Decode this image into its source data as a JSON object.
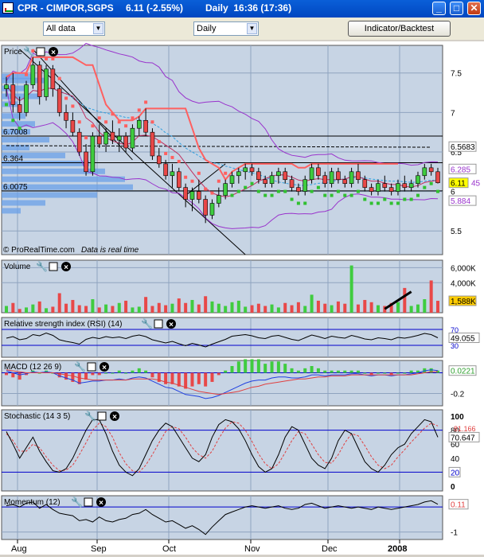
{
  "window": {
    "title_symbol": "CPR - CIMPOR,SGPS",
    "title_price": "6.11 (-2.55%)",
    "title_interval": "Daily  16:36 (17:36)",
    "minimize": "_",
    "maximize": "□",
    "close": "✕"
  },
  "toolbar": {
    "data_select": "All data",
    "period_select": "Daily",
    "indicator_button": "Indicator/Backtest"
  },
  "colors": {
    "panel_bg": "#c7d4e4",
    "up": "#3fcc3f",
    "down": "#e84848",
    "sar_red": "#ff6060",
    "sar_green": "#30c030",
    "band": "#9933cc"
  },
  "chart_data": [
    {
      "type": "candlestick",
      "panel": "Price",
      "x_ticks": [
        "Aug",
        "Sep",
        "Oct",
        "Nov",
        "Dec",
        "2008"
      ],
      "y_ticks": [
        7.5,
        7,
        6.5,
        6,
        5.5
      ],
      "ylim": [
        5.2,
        7.85
      ],
      "ohlc": [
        [
          7.3,
          7.45,
          7.2,
          7.35
        ],
        [
          7.35,
          7.5,
          7.0,
          7.1
        ],
        [
          7.1,
          7.2,
          6.9,
          7.0
        ],
        [
          7.0,
          7.4,
          6.95,
          7.35
        ],
        [
          7.35,
          7.7,
          7.3,
          7.6
        ],
        [
          7.6,
          7.65,
          7.1,
          7.2
        ],
        [
          7.2,
          7.6,
          7.15,
          7.55
        ],
        [
          7.55,
          7.6,
          7.2,
          7.3
        ],
        [
          7.3,
          7.35,
          6.95,
          7.0
        ],
        [
          7.0,
          7.1,
          6.8,
          6.9
        ],
        [
          6.9,
          7.0,
          6.7,
          6.75
        ],
        [
          6.75,
          6.8,
          6.45,
          6.5
        ],
        [
          6.5,
          6.6,
          6.2,
          6.25
        ],
        [
          6.25,
          6.75,
          6.2,
          6.7
        ],
        [
          6.7,
          6.85,
          6.55,
          6.6
        ],
        [
          6.6,
          6.8,
          6.5,
          6.75
        ],
        [
          6.75,
          6.9,
          6.6,
          6.65
        ],
        [
          6.65,
          6.8,
          6.5,
          6.7
        ],
        [
          6.7,
          6.75,
          6.5,
          6.55
        ],
        [
          6.55,
          6.85,
          6.5,
          6.8
        ],
        [
          6.8,
          6.95,
          6.7,
          6.9
        ],
        [
          6.9,
          7.05,
          6.7,
          6.75
        ],
        [
          6.75,
          6.8,
          6.4,
          6.45
        ],
        [
          6.45,
          6.55,
          6.3,
          6.35
        ],
        [
          6.35,
          6.4,
          6.15,
          6.2
        ],
        [
          6.2,
          6.35,
          6.05,
          6.25
        ],
        [
          6.25,
          6.3,
          6.0,
          6.05
        ],
        [
          6.05,
          6.1,
          5.8,
          5.9
        ],
        [
          5.9,
          6.05,
          5.75,
          6.0
        ],
        [
          6.0,
          6.15,
          5.85,
          5.9
        ],
        [
          5.9,
          5.95,
          5.6,
          5.7
        ],
        [
          5.7,
          5.9,
          5.65,
          5.85
        ],
        [
          5.85,
          6.05,
          5.8,
          5.95
        ],
        [
          5.95,
          6.15,
          5.9,
          6.1
        ],
        [
          6.1,
          6.25,
          6.05,
          6.2
        ],
        [
          6.2,
          6.3,
          6.1,
          6.25
        ],
        [
          6.25,
          6.35,
          6.15,
          6.3
        ],
        [
          6.3,
          6.35,
          6.2,
          6.25
        ],
        [
          6.25,
          6.3,
          6.1,
          6.15
        ],
        [
          6.15,
          6.2,
          6.05,
          6.1
        ],
        [
          6.1,
          6.25,
          6.05,
          6.2
        ],
        [
          6.2,
          6.3,
          6.1,
          6.25
        ],
        [
          6.25,
          6.3,
          6.1,
          6.15
        ],
        [
          6.15,
          6.2,
          6.0,
          6.05
        ],
        [
          6.05,
          6.1,
          5.95,
          6.0
        ],
        [
          6.0,
          6.2,
          5.95,
          6.15
        ],
        [
          6.15,
          6.35,
          6.1,
          6.3
        ],
        [
          6.3,
          6.35,
          6.15,
          6.2
        ],
        [
          6.2,
          6.25,
          6.05,
          6.1
        ],
        [
          6.1,
          6.3,
          6.05,
          6.25
        ],
        [
          6.25,
          6.3,
          6.1,
          6.15
        ],
        [
          6.15,
          6.2,
          6.05,
          6.1
        ],
        [
          6.1,
          6.3,
          6.05,
          6.25
        ],
        [
          6.25,
          6.35,
          6.1,
          6.15
        ],
        [
          6.15,
          6.2,
          6.0,
          6.05
        ],
        [
          6.05,
          6.1,
          5.95,
          6.0
        ],
        [
          6.0,
          6.15,
          5.95,
          6.1
        ],
        [
          6.1,
          6.2,
          6.0,
          6.05
        ],
        [
          6.05,
          6.1,
          5.95,
          6.0
        ],
        [
          6.0,
          6.15,
          5.95,
          6.1
        ],
        [
          6.1,
          6.2,
          6.0,
          6.05
        ],
        [
          6.05,
          6.15,
          6.0,
          6.1
        ],
        [
          6.1,
          6.25,
          6.05,
          6.2
        ],
        [
          6.2,
          6.35,
          6.15,
          6.3
        ],
        [
          6.3,
          6.35,
          6.2,
          6.25
        ],
        [
          6.25,
          6.3,
          6.1,
          6.11
        ]
      ],
      "horizontal_levels": [
        {
          "label": "6.7008",
          "value": 6.7008
        },
        {
          "label": "6.364",
          "value": 6.364
        },
        {
          "label": "6.0075",
          "value": 6.0075
        }
      ],
      "right_labels": [
        {
          "label": "6.5683",
          "value": 6.5683,
          "color": "#ffffff"
        },
        {
          "label": "6.285",
          "value": 6.285,
          "color": "#9933cc"
        },
        {
          "label": "6.11",
          "value": 6.11,
          "color": "#ffff00"
        },
        {
          "label": "45",
          "value": 6.11,
          "color": "#9933cc"
        },
        {
          "label": "5.884",
          "value": 5.884,
          "color": "#9933cc"
        }
      ],
      "footer_left": "© ProRealTime.com",
      "footer_right": "Data is real time"
    },
    {
      "type": "bar",
      "panel": "Volume",
      "y_ticks": [
        "6,000K",
        "4,000K"
      ],
      "ylim": [
        0,
        7000
      ],
      "last_label": "1,588K",
      "values": [
        900,
        1300,
        500,
        700,
        1100,
        1500,
        600,
        800,
        2600,
        1200,
        1700,
        1000,
        900,
        1800,
        700,
        1100,
        900,
        1300,
        1600,
        700,
        800,
        2100,
        900,
        1300,
        1000,
        1200,
        1900,
        1300,
        1700,
        1100,
        2200,
        1500,
        1200,
        900,
        1400,
        1600,
        800,
        1000,
        1200,
        900,
        1100,
        700,
        1300,
        1000,
        1400,
        900,
        2400,
        1600,
        1200,
        1000,
        1500,
        1200,
        6300,
        1100,
        1700,
        1400,
        1000,
        900,
        1300,
        1400,
        3300,
        900,
        1100,
        1800,
        4300,
        1588
      ]
    },
    {
      "type": "line",
      "panel": "Relative strength index (RSI) (14)",
      "y_ticks": [
        "70",
        "30"
      ],
      "ylim": [
        0,
        100
      ],
      "last_label": "49.055",
      "values": [
        48,
        52,
        44,
        47,
        57,
        54,
        61,
        55,
        44,
        40,
        37,
        33,
        45,
        50,
        47,
        52,
        49,
        51,
        47,
        53,
        56,
        52,
        44,
        40,
        36,
        40,
        34,
        29,
        35,
        31,
        26,
        33,
        39,
        45,
        53,
        55,
        57,
        54,
        49,
        47,
        53,
        55,
        50,
        45,
        42,
        49,
        56,
        52,
        47,
        53,
        50,
        48,
        55,
        51,
        46,
        44,
        49,
        47,
        44,
        50,
        48,
        51,
        55,
        60,
        57,
        49
      ]
    },
    {
      "type": "line",
      "panel": "MACD (12 26 9)",
      "y_ticks": [
        "-0.2"
      ],
      "ylim": [
        -0.32,
        0.12
      ],
      "last_label": "0.0221",
      "macd": [
        0.02,
        0.0,
        -0.02,
        -0.01,
        0.01,
        0.0,
        0.01,
        0.0,
        -0.03,
        -0.05,
        -0.07,
        -0.1,
        -0.09,
        -0.08,
        -0.08,
        -0.07,
        -0.07,
        -0.06,
        -0.07,
        -0.05,
        -0.04,
        -0.05,
        -0.08,
        -0.11,
        -0.14,
        -0.15,
        -0.18,
        -0.21,
        -0.22,
        -0.23,
        -0.25,
        -0.24,
        -0.22,
        -0.19,
        -0.16,
        -0.13,
        -0.1,
        -0.08,
        -0.07,
        -0.07,
        -0.05,
        -0.04,
        -0.04,
        -0.05,
        -0.05,
        -0.04,
        -0.02,
        -0.02,
        -0.03,
        -0.02,
        -0.02,
        -0.02,
        -0.01,
        -0.01,
        -0.02,
        -0.03,
        -0.02,
        -0.02,
        -0.03,
        -0.02,
        -0.02,
        -0.01,
        0.0,
        0.02,
        0.03,
        0.022
      ],
      "signal": [
        0.03,
        0.02,
        0.01,
        0.0,
        0.0,
        0.0,
        0.0,
        0.0,
        -0.01,
        -0.02,
        -0.03,
        -0.05,
        -0.06,
        -0.07,
        -0.07,
        -0.07,
        -0.07,
        -0.07,
        -0.07,
        -0.06,
        -0.06,
        -0.06,
        -0.06,
        -0.07,
        -0.09,
        -0.1,
        -0.12,
        -0.14,
        -0.16,
        -0.18,
        -0.19,
        -0.2,
        -0.21,
        -0.2,
        -0.19,
        -0.18,
        -0.16,
        -0.14,
        -0.13,
        -0.11,
        -0.1,
        -0.09,
        -0.08,
        -0.07,
        -0.06,
        -0.06,
        -0.05,
        -0.04,
        -0.04,
        -0.03,
        -0.03,
        -0.03,
        -0.02,
        -0.02,
        -0.02,
        -0.02,
        -0.02,
        -0.02,
        -0.02,
        -0.02,
        -0.02,
        -0.02,
        -0.01,
        0.0,
        0.01,
        0.012
      ]
    },
    {
      "type": "line",
      "panel": "Stochastic (14 3 5)",
      "y_ticks": [
        "100",
        "80",
        "60",
        "40",
        "20",
        "0"
      ],
      "ylim": [
        0,
        100
      ],
      "last_labels": [
        "81.166",
        "70.647",
        "20"
      ],
      "k": [
        78,
        60,
        40,
        55,
        70,
        50,
        35,
        22,
        20,
        25,
        40,
        60,
        80,
        95,
        95,
        75,
        50,
        30,
        20,
        15,
        25,
        45,
        65,
        80,
        90,
        85,
        70,
        55,
        40,
        35,
        45,
        70,
        88,
        95,
        92,
        82,
        65,
        45,
        28,
        20,
        25,
        45,
        70,
        85,
        80,
        60,
        40,
        30,
        25,
        40,
        65,
        80,
        75,
        55,
        35,
        25,
        20,
        30,
        45,
        55,
        60,
        75,
        85,
        95,
        92,
        70
      ],
      "d": [
        75,
        65,
        50,
        50,
        60,
        55,
        42,
        30,
        22,
        23,
        30,
        45,
        62,
        80,
        90,
        85,
        70,
        48,
        32,
        22,
        20,
        30,
        45,
        62,
        78,
        85,
        82,
        70,
        55,
        45,
        40,
        50,
        68,
        83,
        92,
        90,
        80,
        64,
        46,
        32,
        25,
        32,
        48,
        65,
        78,
        75,
        60,
        45,
        34,
        33,
        45,
        62,
        75,
        72,
        58,
        42,
        30,
        25,
        30,
        42,
        52,
        63,
        73,
        83,
        90,
        86
      ]
    },
    {
      "type": "line",
      "panel": "Momentum (12)",
      "y_ticks": [
        "-1"
      ],
      "ylim": [
        -1.3,
        0.45
      ],
      "last_label": "0.11",
      "values": [
        0.05,
        0.1,
        0.0,
        0.15,
        0.2,
        -0.05,
        0.1,
        -0.1,
        -0.25,
        -0.3,
        -0.35,
        -0.55,
        -0.5,
        -0.6,
        -0.4,
        -0.55,
        -0.6,
        -0.5,
        -0.45,
        -0.3,
        -0.25,
        -0.1,
        -0.3,
        -0.45,
        -0.6,
        -0.55,
        -0.7,
        -0.85,
        -0.75,
        -0.9,
        -1.1,
        -0.8,
        -0.55,
        -0.3,
        -0.2,
        -0.1,
        0.0,
        0.05,
        0.0,
        -0.05,
        0.0,
        0.05,
        -0.05,
        -0.1,
        -0.05,
        0.1,
        0.15,
        0.05,
        -0.05,
        0.0,
        0.05,
        0.0,
        -0.05,
        0.0,
        -0.05,
        -0.1,
        0.0,
        -0.05,
        -0.1,
        -0.05,
        0.0,
        0.05,
        0.1,
        0.2,
        0.25,
        0.11
      ]
    }
  ]
}
